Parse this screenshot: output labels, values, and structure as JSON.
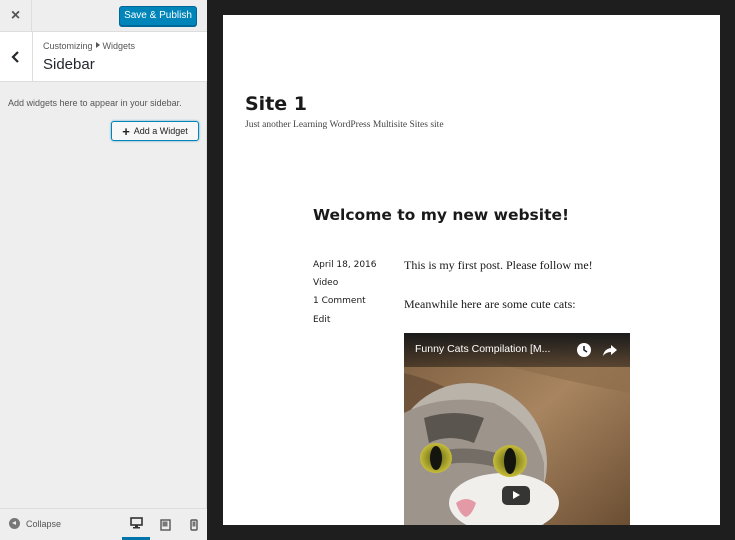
{
  "customizer": {
    "close_label": "×",
    "publish_label": "Save & Publish",
    "breadcrumb": {
      "root": "Customizing",
      "section": "Widgets"
    },
    "section_title": "Sidebar",
    "description": "Add widgets here to appear in your sidebar.",
    "add_widget_label": "Add a Widget",
    "collapse_label": "Collapse",
    "active_device": "desktop",
    "accent_color": "#0085ba"
  },
  "preview": {
    "site_title": "Site 1",
    "tagline": "Just another Learning WordPress Multisite Sites site",
    "post": {
      "title": "Welcome to my new website!",
      "date": "April 18, 2016",
      "format": "Video",
      "comments": "1 Comment",
      "edit": "Edit",
      "paragraphs": [
        "This is my first post. Please follow me!",
        "Meanwhile here are some cute cats:"
      ],
      "video_title": "Funny Cats Compilation [M..."
    }
  }
}
